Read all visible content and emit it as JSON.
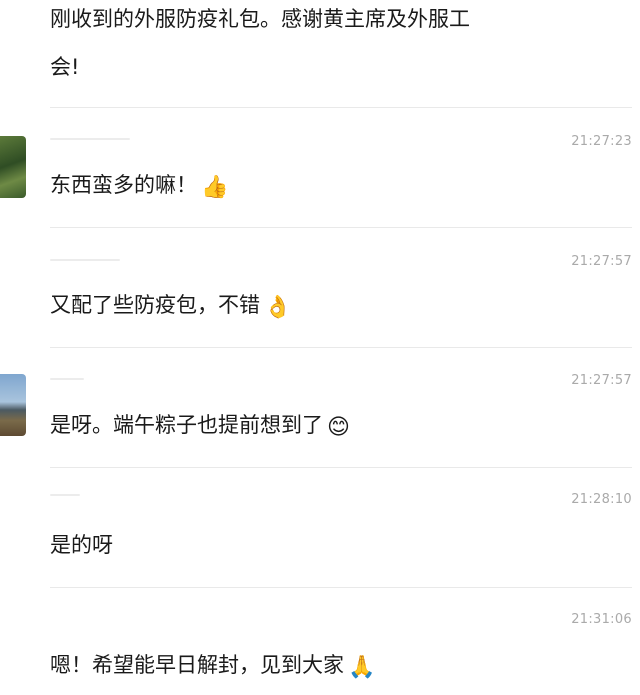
{
  "messages": [
    {
      "text_line1": "刚收到的外服防疫礼包。感谢黄主席及外服工",
      "text_line2": "会!"
    },
    {
      "time": "21:27:23",
      "text": "东西蛮多的嘛！",
      "emoji": "👍",
      "avatar_icon": "green-landscape-avatar"
    },
    {
      "time": "21:27:57",
      "text": "又配了些防疫包，不错",
      "emoji": "👌"
    },
    {
      "time": "21:27:57",
      "text": "是呀。端午粽子也提前想到了",
      "emoji": "😊",
      "avatar_icon": "mountain-landscape-avatar"
    },
    {
      "time": "21:28:10",
      "text": "是的呀"
    },
    {
      "time": "21:31:06",
      "text": "嗯！希望能早日解封，见到大家",
      "emoji": "🙏"
    }
  ]
}
